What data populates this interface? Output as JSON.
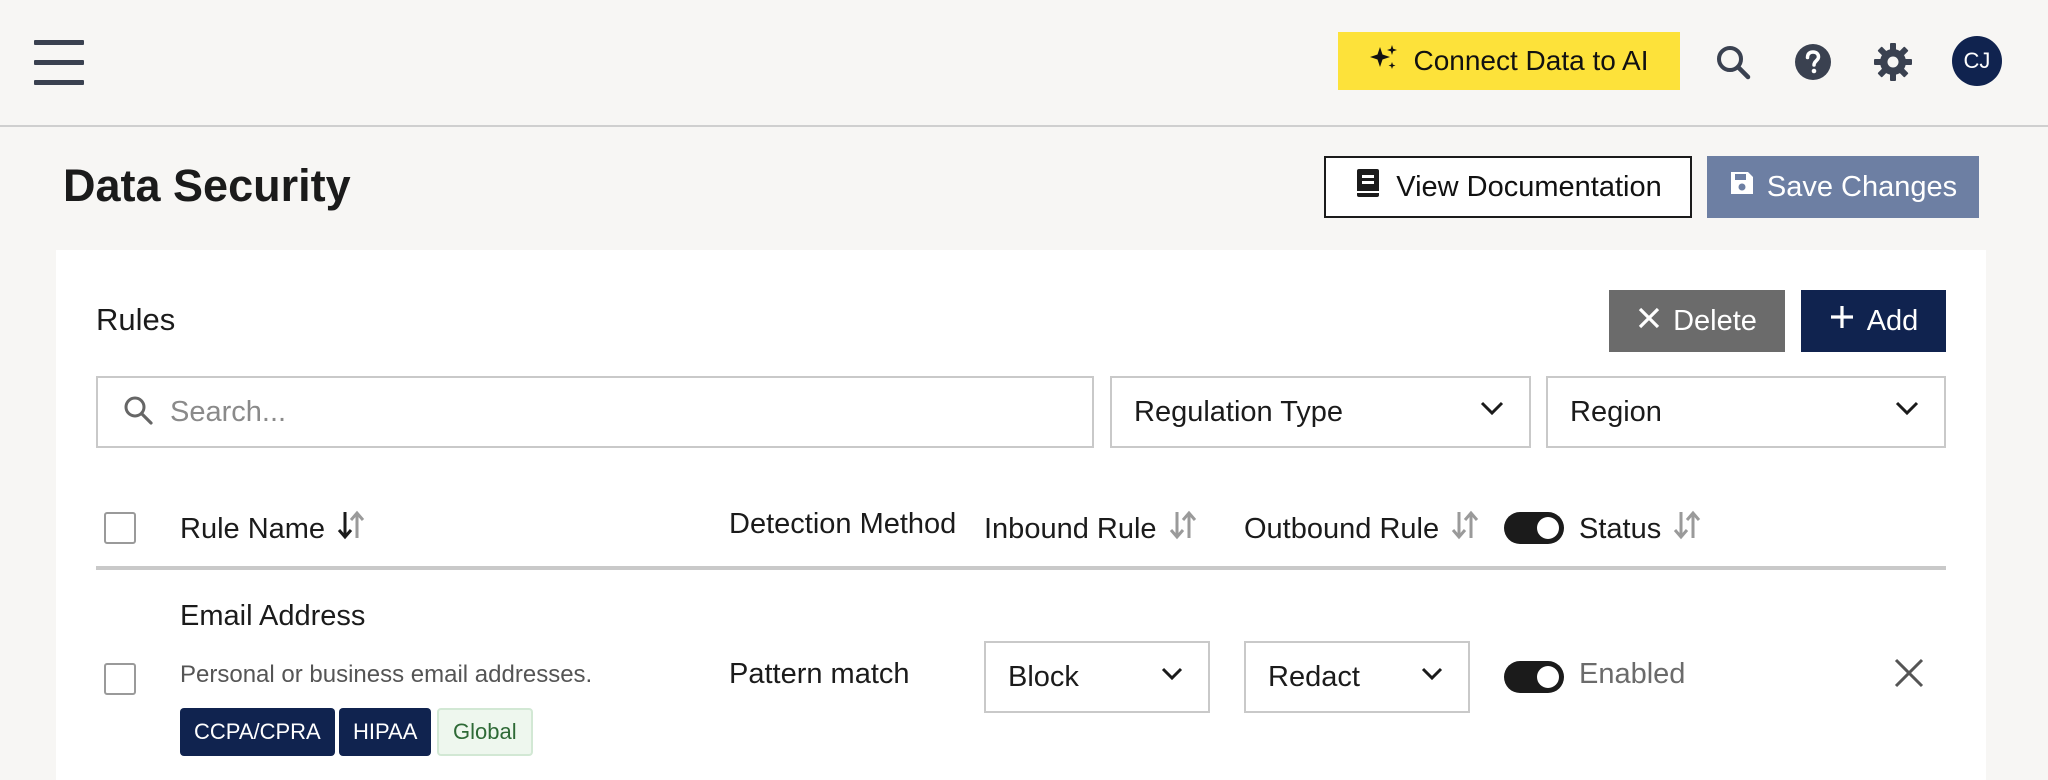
{
  "topbar": {
    "ai_button_label": "Connect Data to AI",
    "avatar_initials": "CJ"
  },
  "page": {
    "title": "Data Security",
    "view_docs_label": "View Documentation",
    "save_label": "Save Changes"
  },
  "rules": {
    "title": "Rules",
    "delete_label": "Delete",
    "add_label": "Add",
    "search_placeholder": "Search...",
    "regulation_filter": "Regulation Type",
    "region_filter": "Region",
    "columns": {
      "rule_name": "Rule Name",
      "detection_method": "Detection Method",
      "inbound_rule": "Inbound Rule",
      "outbound_rule": "Outbound Rule",
      "status": "Status"
    },
    "rows": [
      {
        "name": "Email Address",
        "description": "Personal or business email addresses.",
        "tags": [
          "CCPA/CPRA",
          "HIPAA",
          "Global"
        ],
        "detection_method": "Pattern match",
        "inbound": "Block",
        "outbound": "Redact",
        "status": "Enabled"
      }
    ]
  },
  "colors": {
    "accent_yellow": "#fde23a",
    "navy": "#10234f",
    "save_disabled": "#6d7fa3",
    "delete_gray": "#6b6b6b"
  }
}
